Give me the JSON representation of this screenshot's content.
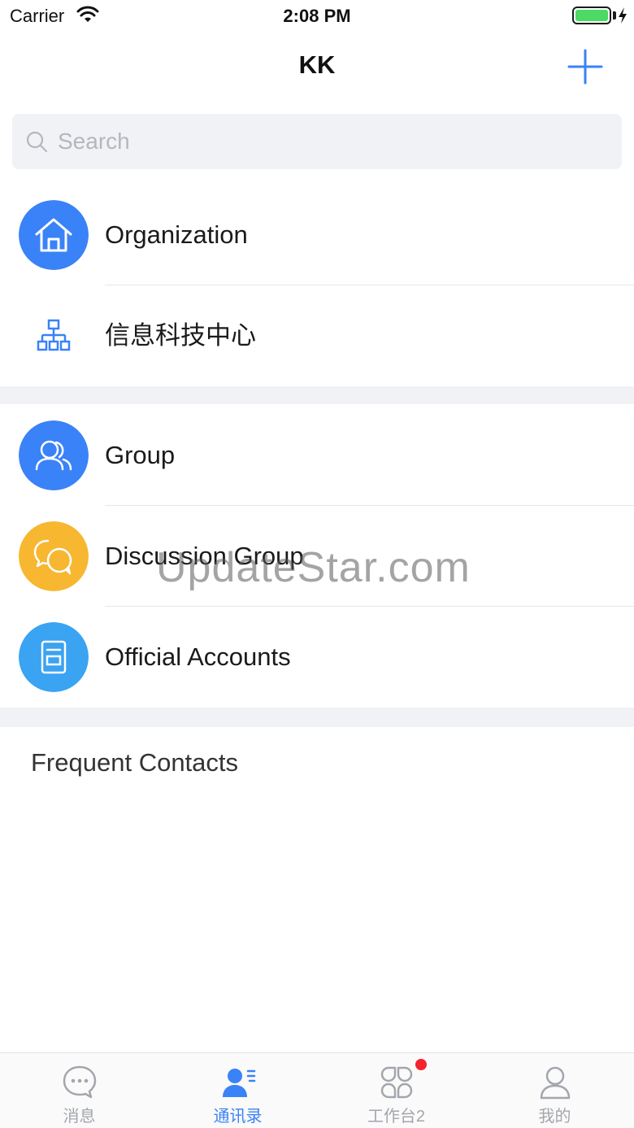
{
  "status_bar": {
    "carrier": "Carrier",
    "time": "2:08 PM"
  },
  "nav": {
    "title": "KK"
  },
  "search": {
    "placeholder": "Search"
  },
  "section1": {
    "items": [
      {
        "label": "Organization",
        "icon": "home-icon",
        "color": "#3a82f7"
      },
      {
        "label": "信息科技中心",
        "icon": "org-chart-icon",
        "color": "#3a82f7"
      }
    ]
  },
  "section2": {
    "items": [
      {
        "label": "Group",
        "icon": "group-icon",
        "color": "#3a82f7"
      },
      {
        "label": "Discussion Group",
        "icon": "chat-bubbles-icon",
        "color": "#f7b731"
      },
      {
        "label": "Official Accounts",
        "icon": "document-icon",
        "color": "#3aa3f2"
      }
    ]
  },
  "frequent": {
    "title": "Frequent Contacts"
  },
  "watermark": "UpdateStar.com",
  "tabs": [
    {
      "label": "消息",
      "icon": "message-icon",
      "active": false
    },
    {
      "label": "通讯录",
      "icon": "contacts-icon",
      "active": true
    },
    {
      "label": "工作台2",
      "icon": "workbench-icon",
      "active": false,
      "badge": true
    },
    {
      "label": "我的",
      "icon": "profile-icon",
      "active": false
    }
  ],
  "colors": {
    "accent": "#3a82f7",
    "badge": "#f5222d",
    "section_bg": "#f1f2f5"
  }
}
